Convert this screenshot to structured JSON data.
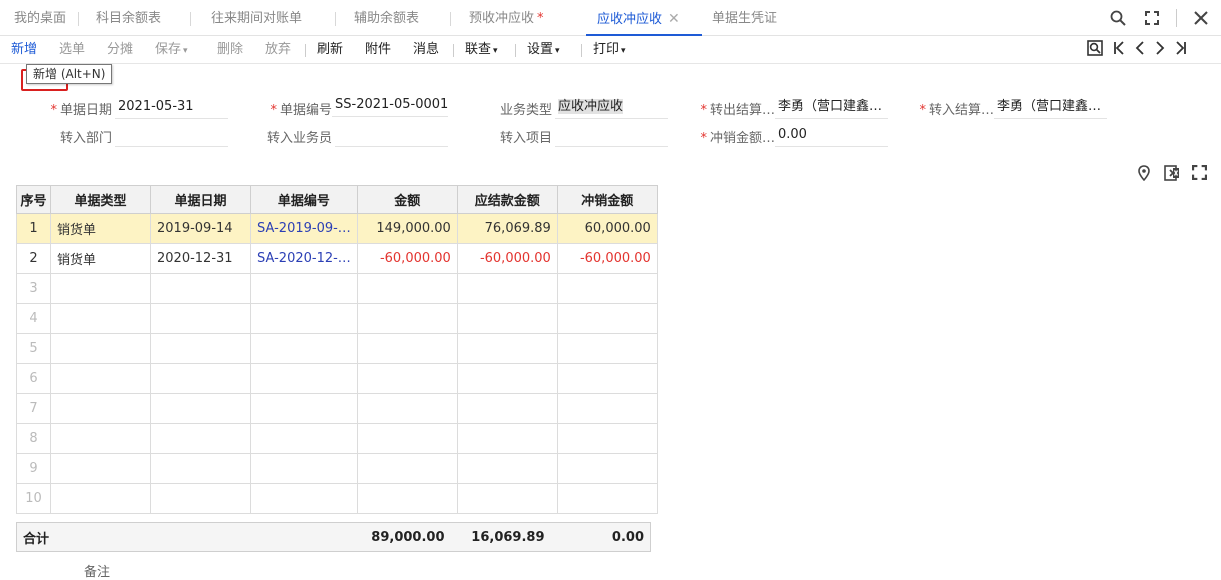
{
  "tabs": [
    {
      "label": "我的桌面"
    },
    {
      "label": "科目余额表"
    },
    {
      "label": "往来期间对账单"
    },
    {
      "label": "辅助余额表"
    },
    {
      "label": "预收冲应收",
      "modified": "*"
    },
    {
      "label": "应收冲应收",
      "close": "✕"
    },
    {
      "label": "单据生凭证"
    }
  ],
  "toolbar": {
    "new": "新增",
    "select": "选单",
    "allocate": "分摊",
    "save": "保存",
    "delete": "删除",
    "abandon": "放弃",
    "refresh": "刷新",
    "attach": "附件",
    "message": "消息",
    "linked": "联查",
    "settings": "设置",
    "print": "打印"
  },
  "tooltip": "新增 (Alt+N)",
  "form": {
    "date_label": "单据日期",
    "date_value": "2021-05-31",
    "no_label": "单据编号",
    "no_value": "SS-2021-05-0001",
    "type_label": "业务类型",
    "type_value": "应收冲应收",
    "out_label": "转出结算…",
    "out_value": "李勇（营口建鑫…",
    "in_label": "转入结算…",
    "in_value": "李勇（营口建鑫…",
    "dept_label": "转入部门",
    "salesman_label": "转入业务员",
    "project_label": "转入项目",
    "amount_label": "冲销金额…",
    "amount_value": "0.00"
  },
  "grid": {
    "headers": [
      "序号",
      "单据类型",
      "单据日期",
      "单据编号",
      "金额",
      "应结款金额",
      "冲销金额"
    ],
    "rows": [
      {
        "idx": "1",
        "type": "销货单",
        "date": "2019-09-14",
        "no": "SA-2019-09-…",
        "amount": "149,000.00",
        "due": "76,069.89",
        "offset": "60,000.00"
      },
      {
        "idx": "2",
        "type": "销货单",
        "date": "2020-12-31",
        "no": "SA-2020-12-…",
        "amount": "-60,000.00",
        "due": "-60,000.00",
        "offset": "-60,000.00"
      }
    ],
    "empty_rows": [
      "3",
      "4",
      "5",
      "6",
      "7",
      "8",
      "9",
      "10"
    ],
    "total": {
      "label": "合计",
      "amount": "89,000.00",
      "due": "16,069.89",
      "offset": "0.00"
    }
  },
  "remark_label": "备注",
  "icons": {
    "tabbar": [
      "search-icon",
      "expand-icon",
      "close-icon"
    ],
    "nav": [
      "find-icon",
      "first-icon",
      "prev-icon",
      "next-icon",
      "last-icon"
    ],
    "panel": [
      "location-icon",
      "excel-icon",
      "fullscreen-icon"
    ]
  },
  "colors": {
    "accent": "#1e5bd6",
    "negative": "#e3342f",
    "selected_row": "#fdf3c4",
    "link": "#2b3fb5"
  }
}
